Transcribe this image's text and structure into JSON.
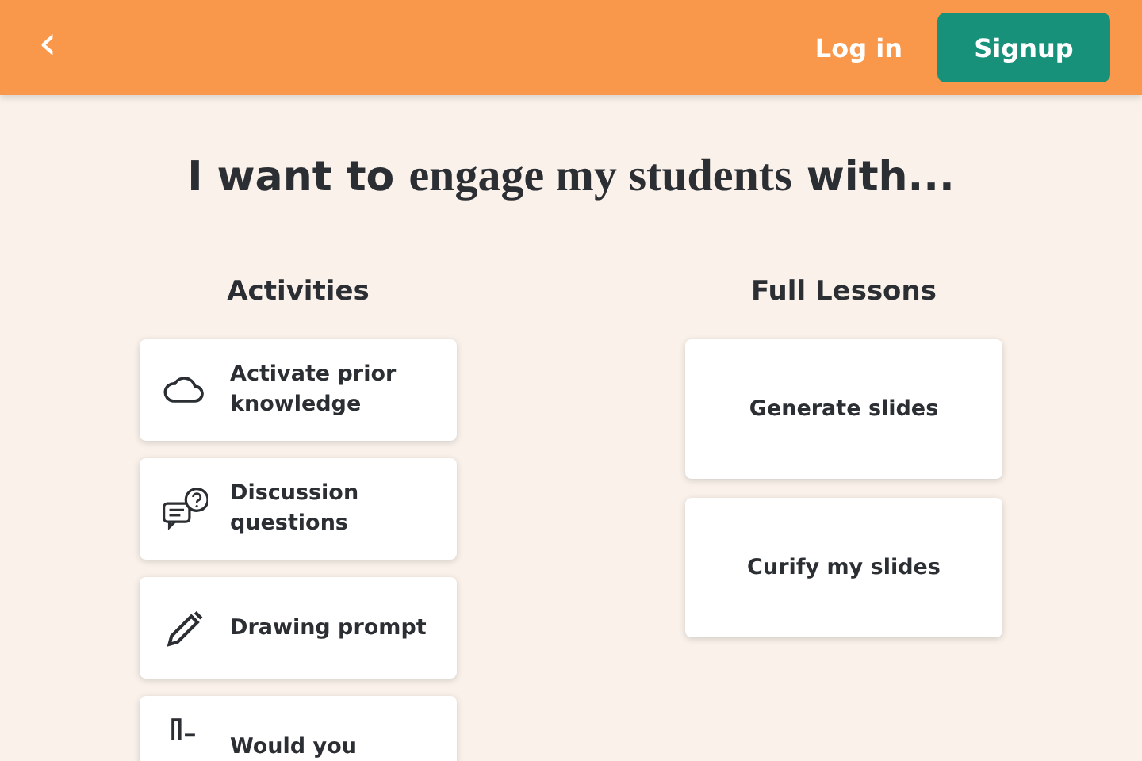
{
  "header": {
    "back": "‹",
    "login": "Log in",
    "signup": "Signup"
  },
  "heading": [
    {
      "text": "I want to ",
      "kind": "sans"
    },
    {
      "text": "engage my students",
      "kind": "serif"
    },
    {
      "text": " with...",
      "kind": "sans"
    }
  ],
  "columns": [
    {
      "title": "Activities",
      "cards": [
        {
          "label": "Activate prior knowledge",
          "kind": "cloud"
        },
        {
          "label": "Discussion questions",
          "kind": "chat"
        },
        {
          "label": "Drawing prompt",
          "kind": "pencil"
        },
        {
          "label": "Would you",
          "kind": "poll"
        }
      ]
    },
    {
      "title": "Full Lessons",
      "cards": [
        {
          "label": "Generate slides",
          "kind": "plain"
        },
        {
          "label": "Curify my slides",
          "kind": "plain"
        }
      ]
    }
  ]
}
